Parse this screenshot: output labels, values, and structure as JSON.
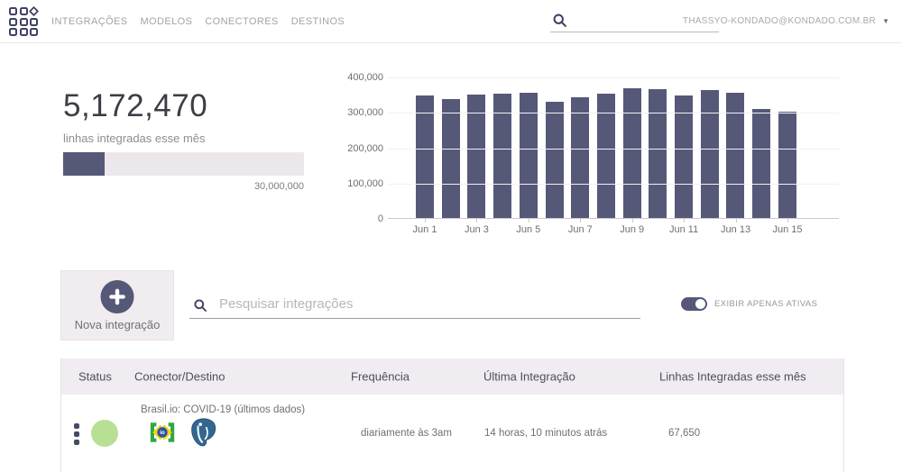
{
  "header": {
    "nav_items": [
      {
        "label": "INTEGRAÇÕES"
      },
      {
        "label": "MODELOS"
      },
      {
        "label": "CONECTORES"
      },
      {
        "label": "DESTINOS"
      }
    ],
    "user_email": "THASSYO-KONDADO@KONDADO.COM.BR",
    "caret": "▼"
  },
  "stats": {
    "value": "5,172,470",
    "label": "linhas integradas esse mês",
    "progress_width": "17.2%",
    "progress_max": "30,000,000"
  },
  "chart_data": {
    "type": "bar",
    "title": "",
    "xlabel": "",
    "ylabel": "",
    "categories": [
      "Jun 1",
      "Jun 2",
      "Jun 3",
      "Jun 4",
      "Jun 5",
      "Jun 6",
      "Jun 7",
      "Jun 8",
      "Jun 9",
      "Jun 10",
      "Jun 11",
      "Jun 12",
      "Jun 13",
      "Jun 14",
      "Jun 15"
    ],
    "values": [
      347000,
      336000,
      350000,
      352000,
      354000,
      328000,
      342000,
      351000,
      366000,
      364000,
      347000,
      362000,
      353000,
      309000,
      301000
    ],
    "xtick_labels": [
      "Jun 1",
      "Jun 3",
      "Jun 5",
      "Jun 7",
      "Jun 9",
      "Jun 11",
      "Jun 13",
      "Jun 15"
    ],
    "ytick_labels": [
      "400,000",
      "300,000",
      "200,000",
      "100,000",
      "0"
    ],
    "ylim": [
      0,
      400000
    ],
    "grid": true,
    "legend": false,
    "bar_color": "#565878"
  },
  "actions": {
    "new_integration_label": "Nova integração",
    "search_placeholder": "Pesquisar integrações",
    "toggle_label": "EXIBIR APENAS ATIVAS",
    "toggle_on": true
  },
  "table": {
    "headers": [
      "Status",
      "Conector/Destino",
      "Frequência",
      "Última Integração",
      "Linhas Integradas esse mês"
    ],
    "rows": [
      {
        "status_color": "#b7e094",
        "title": "Brasil.io: COVID-19 (últimos dados)",
        "source_icon": "brasil-io",
        "destination_icon": "postgresql",
        "source_icon_text": "io",
        "frequency": "diariamente às 3am",
        "last_integration": "14 horas, 10 minutos atrás",
        "lines_this_month": "67,650"
      }
    ]
  },
  "colors": {
    "accent": "#565878",
    "brand_navy": "#3e4166",
    "status_active": "#b7e094",
    "table_header_bg": "#f1ecf1",
    "progress_track": "#ece7eb"
  }
}
